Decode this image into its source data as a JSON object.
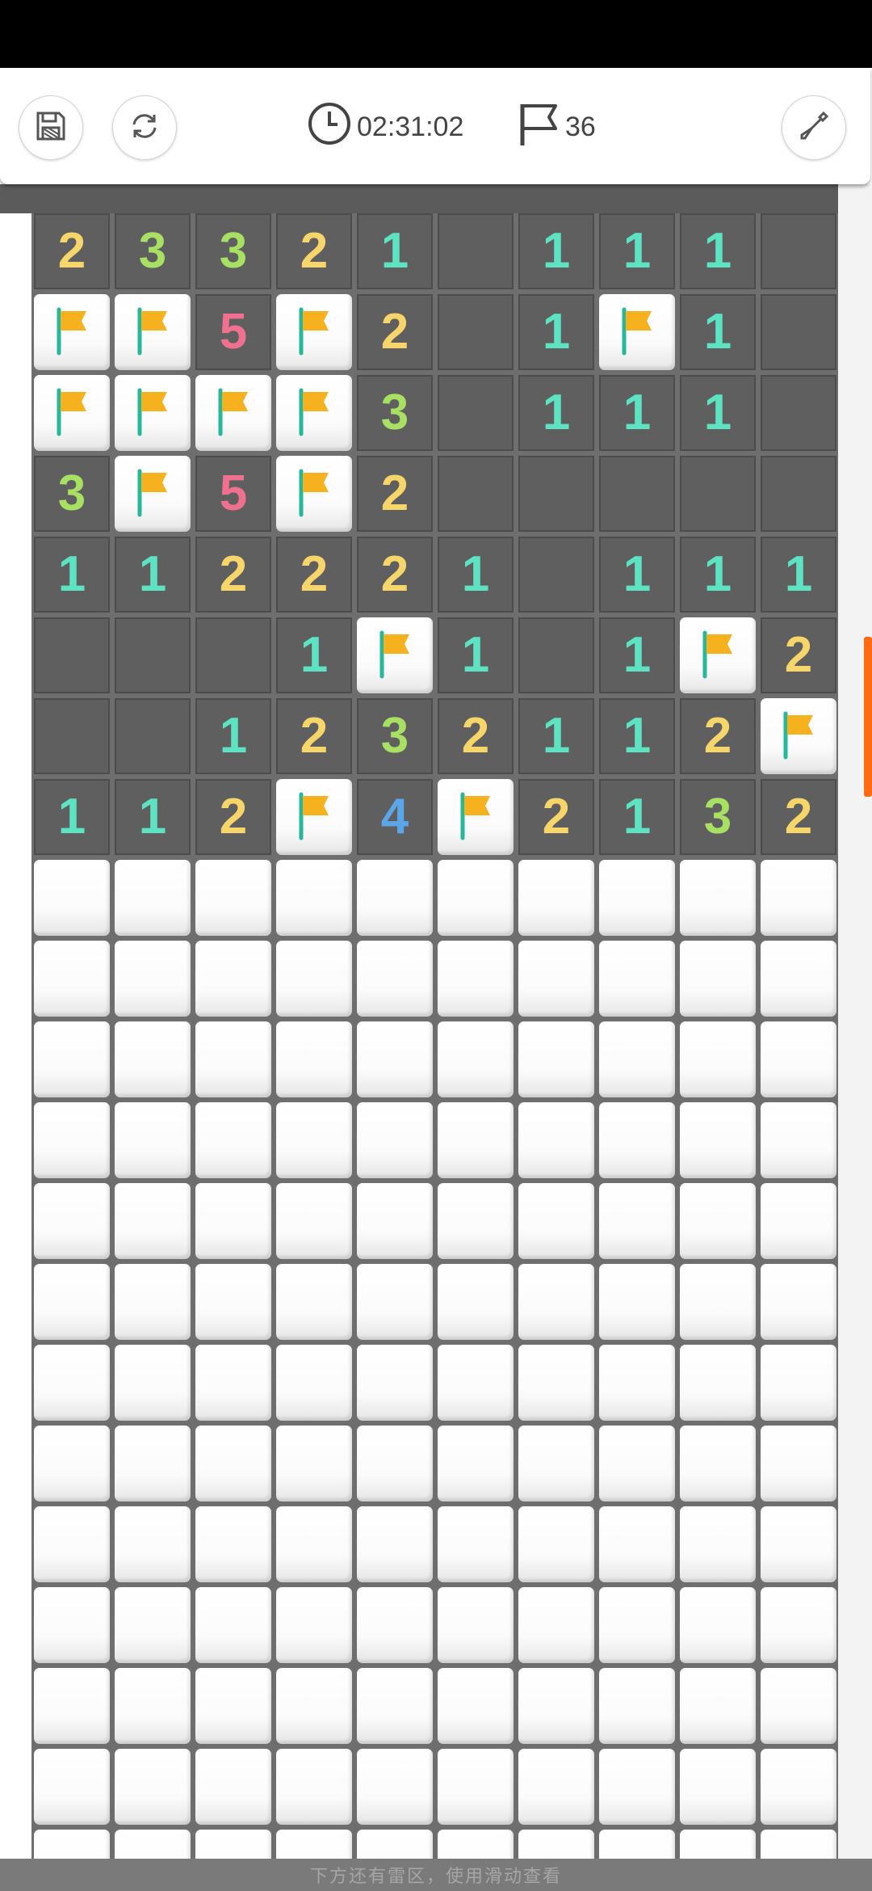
{
  "header": {
    "save_icon": "floppy-disk-icon",
    "restart_icon": "refresh-icon",
    "timer_icon": "clock-icon",
    "timer": "02:31:02",
    "flag_icon": "flag-outline-icon",
    "flags": "36",
    "tool_icon": "shovel-icon"
  },
  "board": {
    "columns": 10,
    "rows": [
      [
        "2",
        "3",
        "3",
        "2",
        "1",
        "",
        "1",
        "1",
        "1",
        ""
      ],
      [
        "F",
        "F",
        "5",
        "F",
        "2",
        "",
        "1",
        "F",
        "1",
        ""
      ],
      [
        "F",
        "F",
        "F",
        "F",
        "3",
        "",
        "1",
        "1",
        "1",
        ""
      ],
      [
        "3",
        "F",
        "5",
        "F",
        "2",
        "",
        "",
        "",
        "",
        ""
      ],
      [
        "1",
        "1",
        "2",
        "2",
        "2",
        "1",
        "",
        "1",
        "1",
        "1"
      ],
      [
        "",
        "",
        "",
        "1",
        "F",
        "1",
        "",
        "1",
        "F",
        "2"
      ],
      [
        "",
        "",
        "1",
        "2",
        "3",
        "2",
        "1",
        "1",
        "2",
        "F"
      ],
      [
        "1",
        "1",
        "2",
        "F",
        "4",
        "F",
        "2",
        "1",
        "3",
        "2"
      ],
      [
        "C",
        "C",
        "C",
        "C",
        "C",
        "C",
        "C",
        "C",
        "C",
        "C"
      ],
      [
        "C",
        "C",
        "C",
        "C",
        "C",
        "C",
        "C",
        "C",
        "C",
        "C"
      ],
      [
        "C",
        "C",
        "C",
        "C",
        "C",
        "C",
        "C",
        "C",
        "C",
        "C"
      ],
      [
        "C",
        "C",
        "C",
        "C",
        "C",
        "C",
        "C",
        "C",
        "C",
        "C"
      ],
      [
        "C",
        "C",
        "C",
        "C",
        "C",
        "C",
        "C",
        "C",
        "C",
        "C"
      ],
      [
        "C",
        "C",
        "C",
        "C",
        "C",
        "C",
        "C",
        "C",
        "C",
        "C"
      ],
      [
        "C",
        "C",
        "C",
        "C",
        "C",
        "C",
        "C",
        "C",
        "C",
        "C"
      ],
      [
        "C",
        "C",
        "C",
        "C",
        "C",
        "C",
        "C",
        "C",
        "C",
        "C"
      ],
      [
        "C",
        "C",
        "C",
        "C",
        "C",
        "C",
        "C",
        "C",
        "C",
        "C"
      ],
      [
        "C",
        "C",
        "C",
        "C",
        "C",
        "C",
        "C",
        "C",
        "C",
        "C"
      ],
      [
        "C",
        "C",
        "C",
        "C",
        "C",
        "C",
        "C",
        "C",
        "C",
        "C"
      ],
      [
        "C",
        "C",
        "C",
        "C",
        "C",
        "C",
        "C",
        "C",
        "C",
        "C"
      ],
      [
        "C",
        "C",
        "C",
        "C",
        "C",
        "C",
        "C",
        "C",
        "C",
        "C"
      ]
    ],
    "number_colors": {
      "1": "#5ee3c2",
      "2": "#f6d66a",
      "3": "#a8e063",
      "4": "#5aa6e8",
      "5": "#f0708f"
    },
    "flag_color": "#f5b21e",
    "flag_pole_color": "#27b89a"
  },
  "footer": {
    "hint": "下方还有雷区，使用滑动查看"
  }
}
